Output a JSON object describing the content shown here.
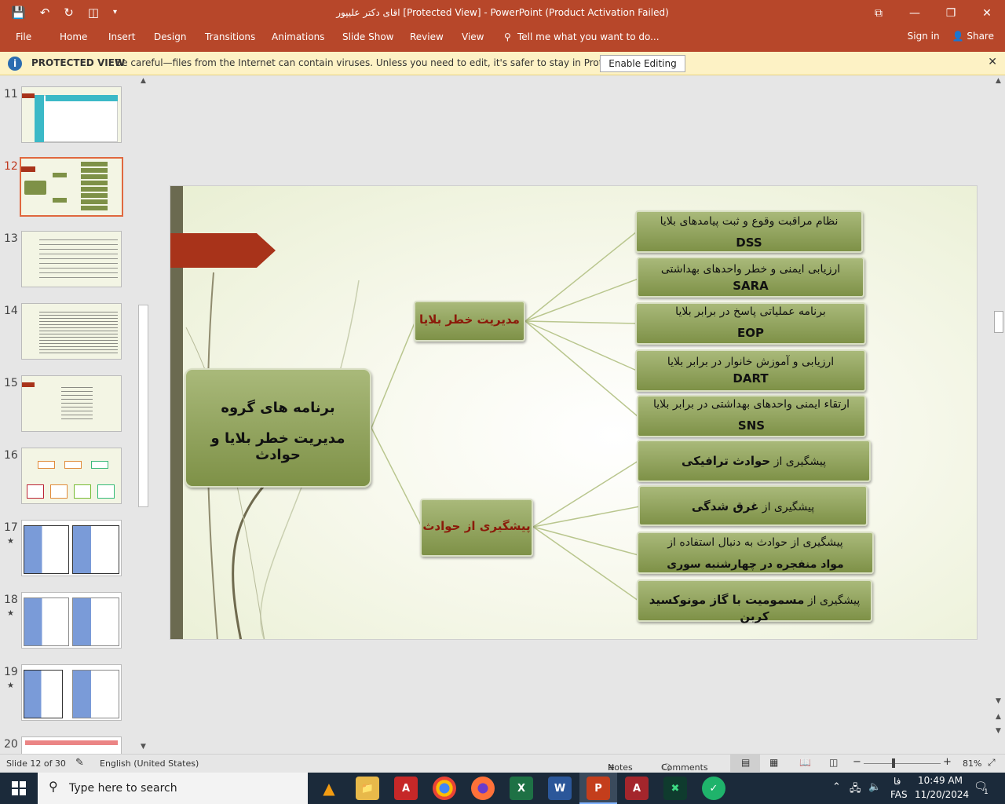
{
  "window": {
    "title": "اقای دکتر علیپور [Protected View] - PowerPoint (Product Activation Failed)",
    "buttons": [
      "⧉",
      "—",
      "❐",
      "✕"
    ]
  },
  "ribbon": {
    "tabs": [
      "File",
      "Home",
      "Insert",
      "Design",
      "Transitions",
      "Animations",
      "Slide Show",
      "Review",
      "View"
    ],
    "tell_me": "Tell me what you want to do...",
    "sign_in": "Sign in",
    "share": "Share"
  },
  "protected_view": {
    "label": "PROTECTED VIEW",
    "message": "Be careful—files from the Internet can contain viruses. Unless you need to edit, it's safer to stay in Protected View.",
    "button": "Enable Editing"
  },
  "thumbnails": [
    {
      "num": "11",
      "star": false,
      "selected": false
    },
    {
      "num": "12",
      "star": false,
      "selected": true
    },
    {
      "num": "13",
      "star": false,
      "selected": false
    },
    {
      "num": "14",
      "star": false,
      "selected": false
    },
    {
      "num": "15",
      "star": false,
      "selected": false
    },
    {
      "num": "16",
      "star": false,
      "selected": false
    },
    {
      "num": "17",
      "star": true,
      "selected": false
    },
    {
      "num": "18",
      "star": true,
      "selected": false
    },
    {
      "num": "19",
      "star": true,
      "selected": false
    },
    {
      "num": "20",
      "star": true,
      "selected": false
    }
  ],
  "slide": {
    "center": {
      "line1": "برنامه های گروه",
      "line2": "مدیریت خطر بلایا و حوادث"
    },
    "branch1": "مدیریت خطر بلایا",
    "branch2": "پیشگیری از حوادث",
    "items": [
      {
        "l1": "نظام مراقبت وقوع و ثبت پیامدهای بلایا",
        "l2": "DSS"
      },
      {
        "l1": "ارزیابی ایمنی و خطر واحدهای بهداشتی",
        "l2": "SARA"
      },
      {
        "l1": "برنامه عملیاتی پاسخ در برابر بلایا",
        "l2": "EOP"
      },
      {
        "l1": "ارزیابی و آموزش خانوار در برابر بلایا",
        "l2": "DART"
      },
      {
        "l1": "ارتقاء ایمنی واحدهای بهداشتی در برابر بلایا",
        "l2": "SNS"
      }
    ],
    "items2": [
      {
        "pre": "پیشگیری از ",
        "bold": "حوادث ترافیکی"
      },
      {
        "pre": "پیشگیری از ",
        "bold": "غرق شدگی"
      },
      {
        "pre": "پیشگیری از حوادث به دنبال استفاده از",
        "bold": "مواد منفجره در چهارشنبه سوری"
      },
      {
        "pre": "پیشگیری از ",
        "bold": "مسمومیت با گاز مونوکسید کربن"
      }
    ]
  },
  "status": {
    "slide": "Slide 12 of 30",
    "language": "English (United States)",
    "notes": "Notes",
    "comments": "Comments",
    "zoom": "81%"
  },
  "taskbar": {
    "search_placeholder": "Type here to search",
    "lang1": "فا",
    "lang2": "FAS",
    "time": "10:49 AM",
    "date": "11/20/2024",
    "notification_count": "1"
  },
  "colors": {
    "accent": "#b7472a",
    "box": "#8ea35a",
    "banner": "#a8331a"
  }
}
